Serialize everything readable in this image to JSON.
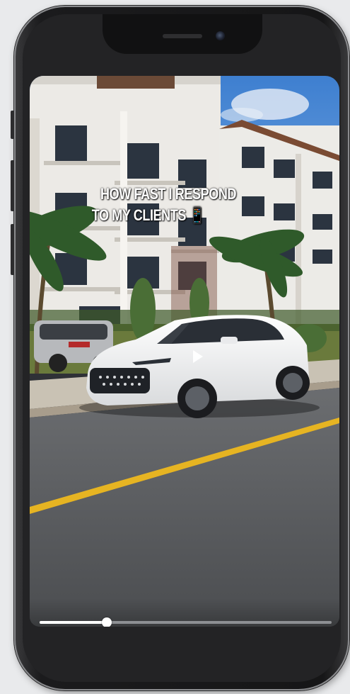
{
  "video": {
    "caption_line1": "HOW FAST I RESPOND",
    "caption_line2": "TO MY CLIENTS 📱",
    "play_icon": "play-icon",
    "progress": 0.23
  },
  "colors": {
    "sky": "#4f8fd8",
    "road": "#5f6165",
    "road_line": "#e6b422",
    "car": "#f1f2f3",
    "bezel": "#1b1b1d"
  }
}
